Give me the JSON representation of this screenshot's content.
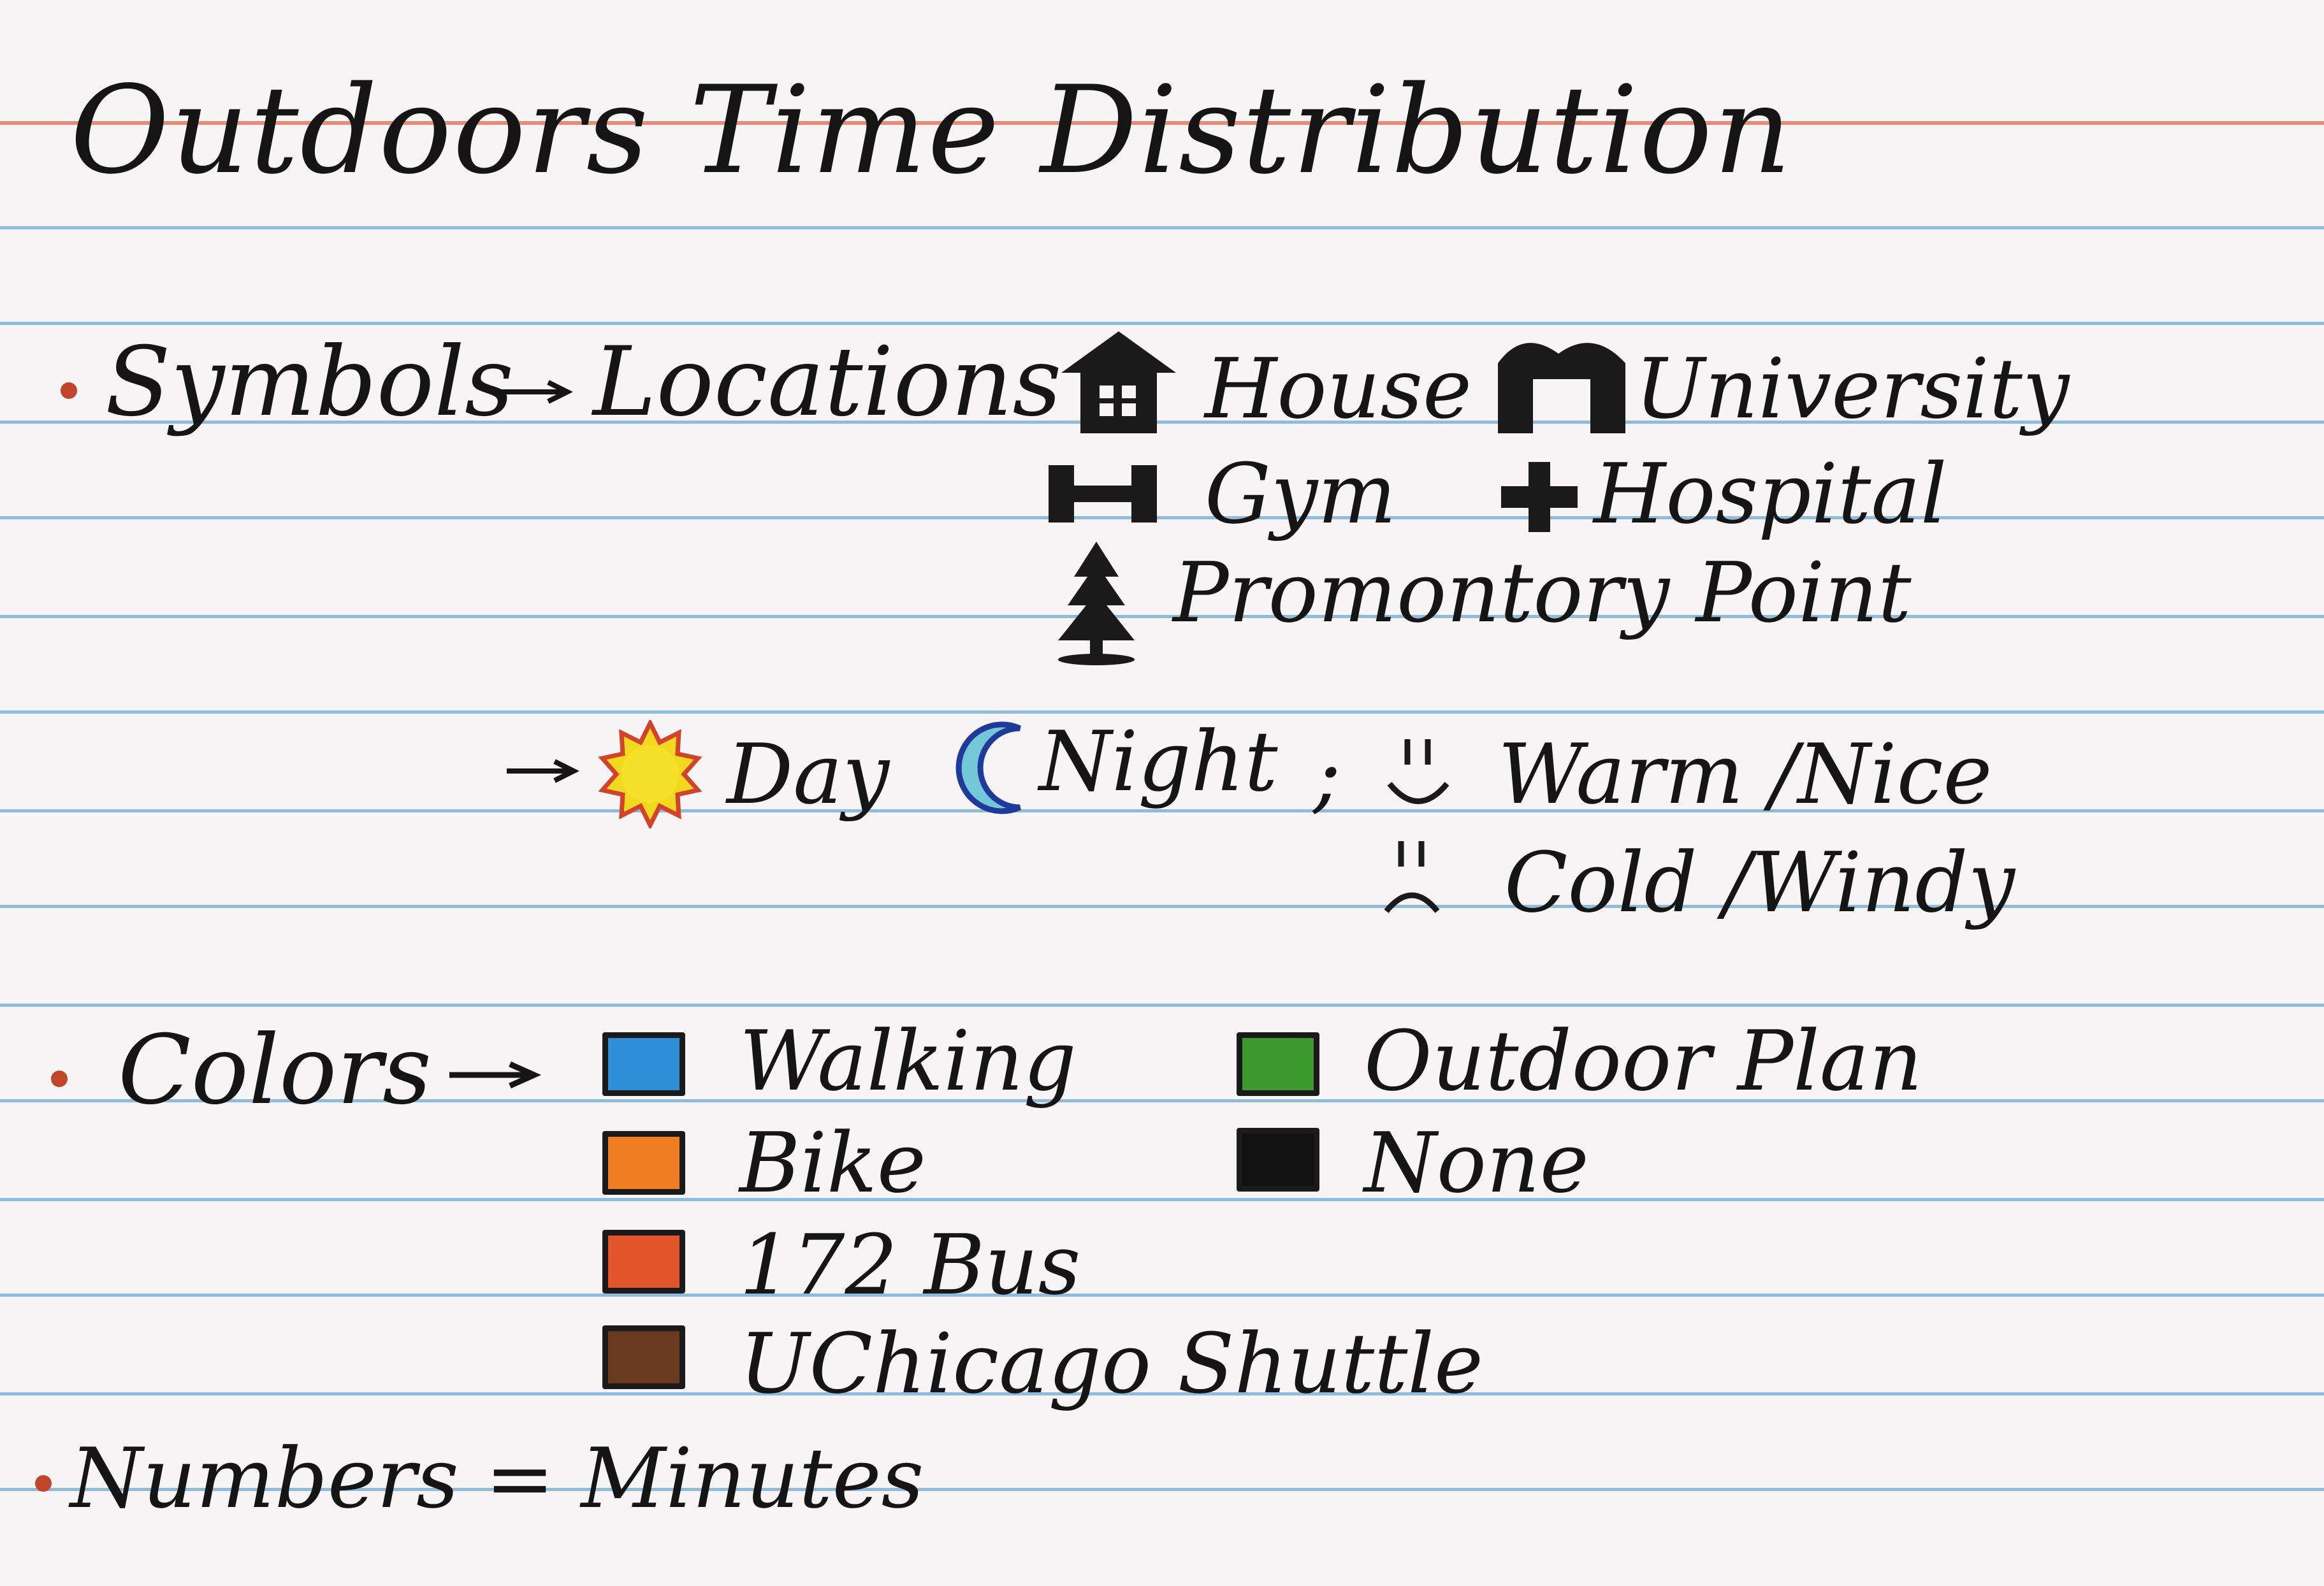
{
  "title": "Outdoors Time Distribution",
  "symbols": {
    "label": "Symbols",
    "locations_label": "Locations :",
    "locations": [
      {
        "name": "House",
        "icon": "house-icon"
      },
      {
        "name": "University",
        "icon": "university-icon"
      },
      {
        "name": "Gym",
        "icon": "dumbbell-icon"
      },
      {
        "name": "Hospital",
        "icon": "cross-icon"
      },
      {
        "name": "Promontory Point",
        "icon": "tree-icon"
      }
    ],
    "time": [
      {
        "name": "Day",
        "icon": "sun-icon"
      },
      {
        "name": "Night",
        "icon": "moon-icon"
      }
    ],
    "separator": ";",
    "weather": [
      {
        "name": "Warm /Nice",
        "icon": "smile-icon"
      },
      {
        "name": "Cold /Windy",
        "icon": "frown-icon"
      }
    ]
  },
  "colors": {
    "label": "Colors",
    "items": [
      {
        "name": "Walking",
        "color": "#2f8fd6"
      },
      {
        "name": "Bike",
        "color": "#ef7d22"
      },
      {
        "name": "172 Bus",
        "color": "#e2542a"
      },
      {
        "name": "UChicago Shuttle",
        "color": "#6a3a20"
      },
      {
        "name": "Outdoor Plan",
        "color": "#3d9a2e"
      },
      {
        "name": "None",
        "color": "#111111"
      }
    ]
  },
  "numbers": {
    "label": "Numbers = Minutes"
  }
}
